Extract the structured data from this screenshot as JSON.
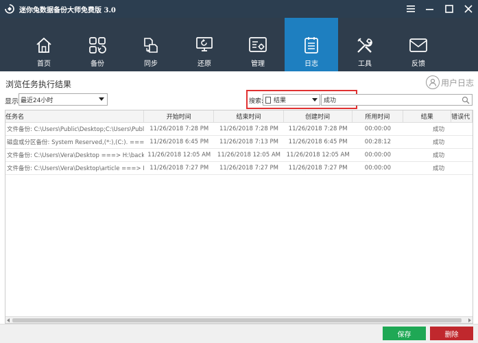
{
  "window": {
    "title": "迷你兔数据备份大师免费版 3.0"
  },
  "toolbar": {
    "items": [
      {
        "label": "首页",
        "icon": "home-icon"
      },
      {
        "label": "备份",
        "icon": "backup-icon"
      },
      {
        "label": "同步",
        "icon": "sync-icon"
      },
      {
        "label": "还原",
        "icon": "restore-icon"
      },
      {
        "label": "管理",
        "icon": "manage-icon"
      },
      {
        "label": "日志",
        "icon": "log-icon",
        "active": true
      },
      {
        "label": "工具",
        "icon": "tools-icon"
      },
      {
        "label": "反馈",
        "icon": "feedback-icon"
      }
    ],
    "active_color": "#1e7fc0"
  },
  "main": {
    "section_title": "浏览任务执行结果",
    "user_log_label": "用户日志",
    "show_label": "显示",
    "show_value": "最近24小时",
    "search_label": "搜索:",
    "search_field_value": "结果",
    "search_text": "成功"
  },
  "table": {
    "headers": [
      "任务名",
      "开始时间",
      "结束时间",
      "创建时间",
      "所用时间",
      "结果",
      "错误代"
    ],
    "rows": [
      [
        "文件备份: C:\\Users\\Public\\Desktop;C:\\Users\\Public...",
        "11/26/2018 7:28 PM",
        "11/26/2018 7:28 PM",
        "11/26/2018 7:28 PM",
        "00:00:00",
        "成功",
        ""
      ],
      [
        "磁盘或分区备份: System Reserved,(*:),(C:). ===> ...",
        "11/26/2018 6:45 PM",
        "11/26/2018 7:13 PM",
        "11/26/2018 6:45 PM",
        "00:28:12",
        "成功",
        ""
      ],
      [
        "文件备份: C:\\Users\\Vera\\Desktop ===> H:\\backupd...",
        "11/26/2018 12:05 AM",
        "11/26/2018 12:05 AM",
        "11/26/2018 12:05 AM",
        "00:00:00",
        "成功",
        ""
      ],
      [
        "文件备份: C:\\Users\\Vera\\Desktop\\article ===> H:\\b...",
        "11/26/2018 7:27 PM",
        "11/26/2018 7:27 PM",
        "11/26/2018 7:27 PM",
        "00:00:00",
        "成功",
        ""
      ]
    ]
  },
  "footer": {
    "save_label": "保存",
    "delete_label": "删除",
    "save_color": "#1fa855",
    "delete_color": "#c0282d"
  }
}
